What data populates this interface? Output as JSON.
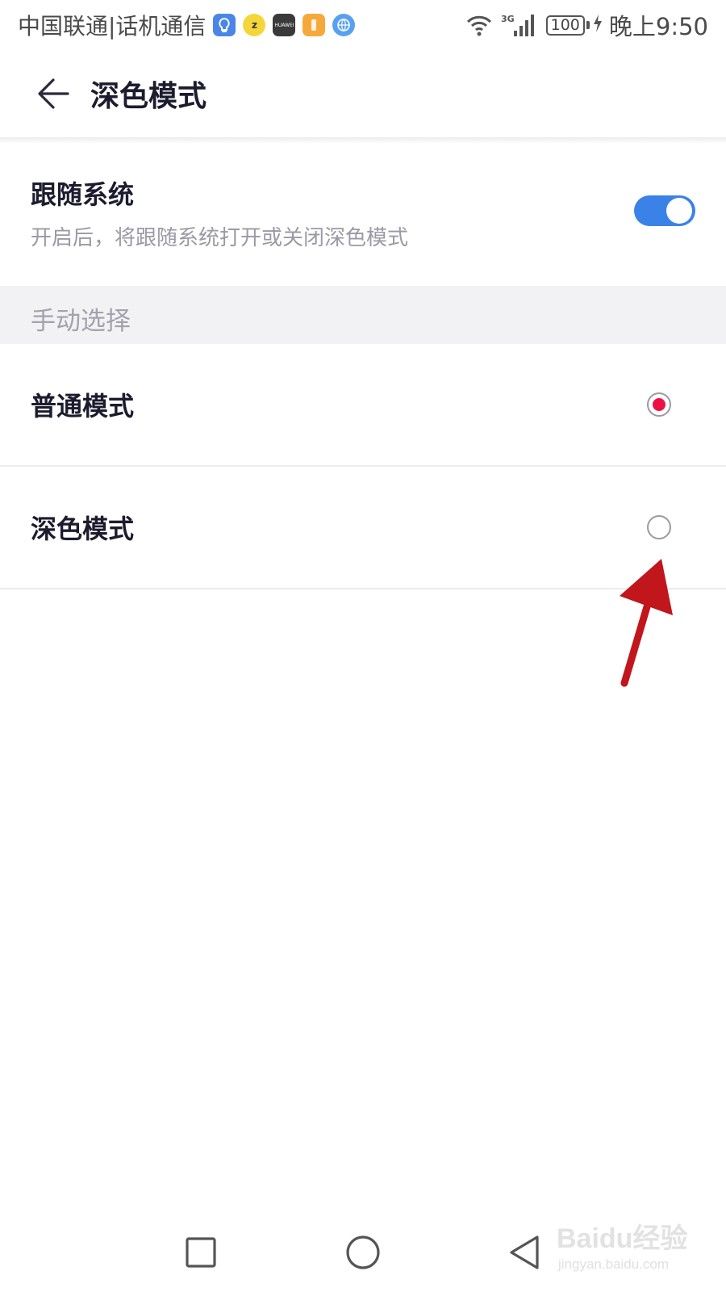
{
  "status_bar": {
    "carrier": "中国联通|话机通信",
    "app_icons": [
      "bulb-app-icon",
      "yellow-app-icon",
      "huawei-store-icon",
      "orange-app-icon",
      "browser-app-icon"
    ],
    "network": "3G",
    "battery": "100",
    "time": "晚上9:50"
  },
  "app_bar": {
    "title": "深色模式",
    "back_icon": "arrow-left-icon"
  },
  "follow_system": {
    "title": "跟随系统",
    "description": "开启后，将跟随系统打开或关闭深色模式",
    "enabled": true,
    "toggle_color": "#3b82e8"
  },
  "manual_section": {
    "label": "手动选择"
  },
  "options": [
    {
      "label": "普通模式",
      "selected": true
    },
    {
      "label": "深色模式",
      "selected": false
    }
  ],
  "accent_color": "#ee1144",
  "annotation": {
    "type": "red-arrow",
    "color": "#c0161c",
    "points_to": "深色模式 radio"
  },
  "nav_bar": {
    "recents_icon": "square-icon",
    "home_icon": "circle-icon",
    "back_icon": "triangle-back-icon"
  },
  "watermark": {
    "brand": "Baidu经验",
    "url": "jingyan.baidu.com"
  }
}
